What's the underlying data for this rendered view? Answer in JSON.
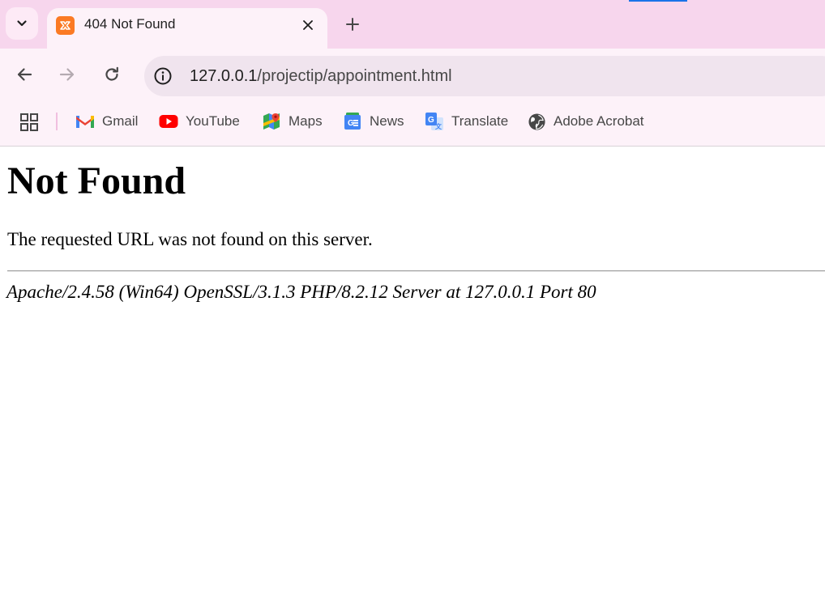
{
  "browser": {
    "tab": {
      "title": "404 Not Found",
      "favicon": "xampp-icon"
    },
    "omnibox": {
      "url_host": "127.0.0.1",
      "url_path": "/projectip/appointment.html"
    },
    "bookmarks": [
      {
        "label": "Gmail",
        "icon": "gmail-icon"
      },
      {
        "label": "YouTube",
        "icon": "youtube-icon"
      },
      {
        "label": "Maps",
        "icon": "maps-icon"
      },
      {
        "label": "News",
        "icon": "news-icon"
      },
      {
        "label": "Translate",
        "icon": "translate-icon"
      },
      {
        "label": "Adobe Acrobat",
        "icon": "globe-icon"
      }
    ]
  },
  "page": {
    "heading": "Not Found",
    "message": "The requested URL was not found on this server.",
    "server_signature": "Apache/2.4.58 (Win64) OpenSSL/3.1.3 PHP/8.2.12 Server at 127.0.0.1 Port 80"
  },
  "colors": {
    "tabstrip": "#f7d6ed",
    "toolbar": "#fdf2f9",
    "accent": "#1a73e8",
    "favicon": "#fb7a24"
  }
}
